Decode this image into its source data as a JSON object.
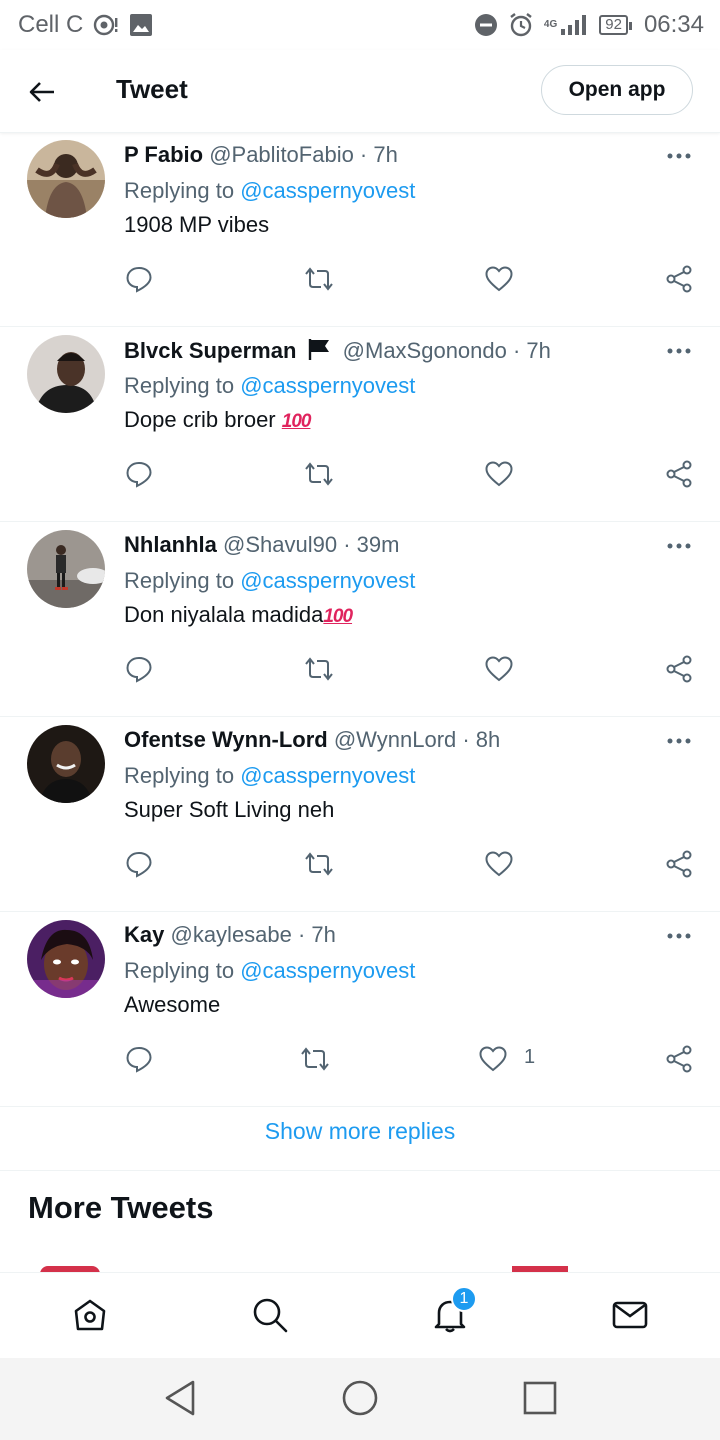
{
  "status_bar": {
    "carrier": "Cell C",
    "network": "4G",
    "battery": "92",
    "time": "06:34"
  },
  "header": {
    "title": "Tweet",
    "open_app_label": "Open app"
  },
  "tweets": [
    {
      "name": "P Fabio",
      "handle": "@PablitoFabio · 7h",
      "replying_prefix": "Replying to",
      "mention": "@casspernyovest",
      "text": "1908 MP vibes",
      "emoji": "",
      "like_count": "",
      "avatar_color": "#b9a58c"
    },
    {
      "name": "Blvck Superman",
      "handle": "@MaxSgonondo · 7h",
      "replying_prefix": "Replying to",
      "mention": "@casspernyovest",
      "text": "Dope crib broer",
      "emoji": "100",
      "like_count": "",
      "avatar_color": "#5a4a44"
    },
    {
      "name": "Nhlanhla",
      "handle": "@Shavul90 · 39m",
      "replying_prefix": "Replying to",
      "mention": "@casspernyovest",
      "text": "Don niyalala madida",
      "emoji": "100",
      "like_count": "",
      "avatar_color": "#8a8680"
    },
    {
      "name": "Ofentse Wynn-Lord",
      "handle": "@WynnLord · 8h",
      "replying_prefix": "Replying to",
      "mention": "@casspernyovest",
      "text": "Super Soft Living neh",
      "emoji": "",
      "like_count": "",
      "avatar_color": "#2e2622"
    },
    {
      "name": "Kay",
      "handle": "@kaylesabe · 7h",
      "replying_prefix": "Replying to",
      "mention": "@casspernyovest",
      "text": "Awesome",
      "emoji": "",
      "like_count": "1",
      "avatar_color": "#7d3a8e"
    }
  ],
  "show_more_label": "Show more replies",
  "more_tweets_title": "More Tweets",
  "bottom_nav": {
    "notification_badge": "1"
  },
  "colors": {
    "accent": "#1d9bf0",
    "text": "#0f1419",
    "secondary": "#536471"
  }
}
